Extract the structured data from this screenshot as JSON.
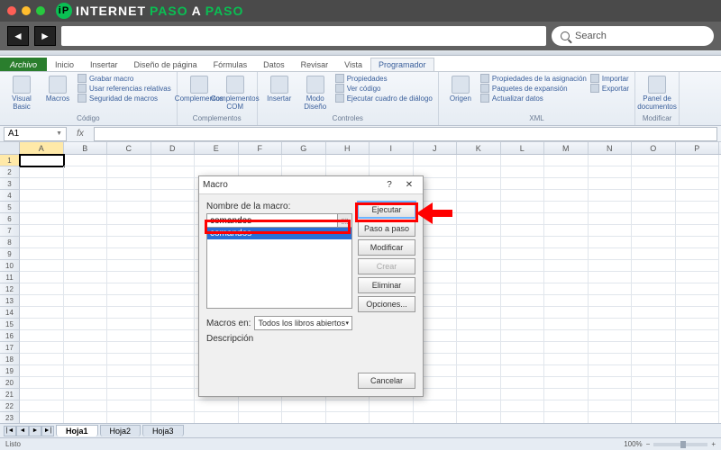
{
  "browser": {
    "logo_left": "INTERNET",
    "logo_mid": "PASO",
    "logo_right": "A",
    "logo_end": "PASO",
    "search_placeholder": "Search"
  },
  "tabs": {
    "file": "Archivo",
    "items": [
      "Inicio",
      "Insertar",
      "Diseño de página",
      "Fórmulas",
      "Datos",
      "Revisar",
      "Vista",
      "Programador"
    ],
    "active": "Programador"
  },
  "ribbon": {
    "g1": {
      "label": "Código",
      "visual_basic": "Visual\nBasic",
      "macros": "Macros",
      "grabar": "Grabar macro",
      "refs": "Usar referencias relativas",
      "seg": "Seguridad de macros"
    },
    "g2": {
      "label": "Complementos",
      "comp": "Complementos",
      "com": "Complementos\nCOM"
    },
    "g3": {
      "label": "Controles",
      "insertar": "Insertar",
      "modo": "Modo\nDiseño",
      "prop": "Propiedades",
      "ver": "Ver código",
      "ejec": "Ejecutar cuadro de diálogo"
    },
    "g4": {
      "label": "XML",
      "origen": "Origen",
      "propasig": "Propiedades de la asignación",
      "paq": "Paquetes de expansión",
      "act": "Actualizar datos",
      "imp": "Importar",
      "exp": "Exportar"
    },
    "g5": {
      "label": "Modificar",
      "panel": "Panel de\ndocumentos"
    }
  },
  "namebox": "A1",
  "columns": [
    "A",
    "B",
    "C",
    "D",
    "E",
    "F",
    "G",
    "H",
    "I",
    "J",
    "K",
    "L",
    "M",
    "N",
    "O",
    "P"
  ],
  "sheets": {
    "s1": "Hoja1",
    "s2": "Hoja2",
    "s3": "Hoja3"
  },
  "status": {
    "ready": "Listo",
    "zoom": "100%"
  },
  "dialog": {
    "title": "Macro",
    "name_label": "Nombre de la macro:",
    "name_value": "comandos",
    "list_item": "comandos",
    "btn_run": "Ejecutar",
    "btn_step": "Paso a paso",
    "btn_edit": "Modificar",
    "btn_create": "Crear",
    "btn_delete": "Eliminar",
    "btn_options": "Opciones...",
    "macros_in_label": "Macros en:",
    "macros_in_value": "Todos los libros abiertos",
    "desc_label": "Descripción",
    "btn_cancel": "Cancelar"
  }
}
